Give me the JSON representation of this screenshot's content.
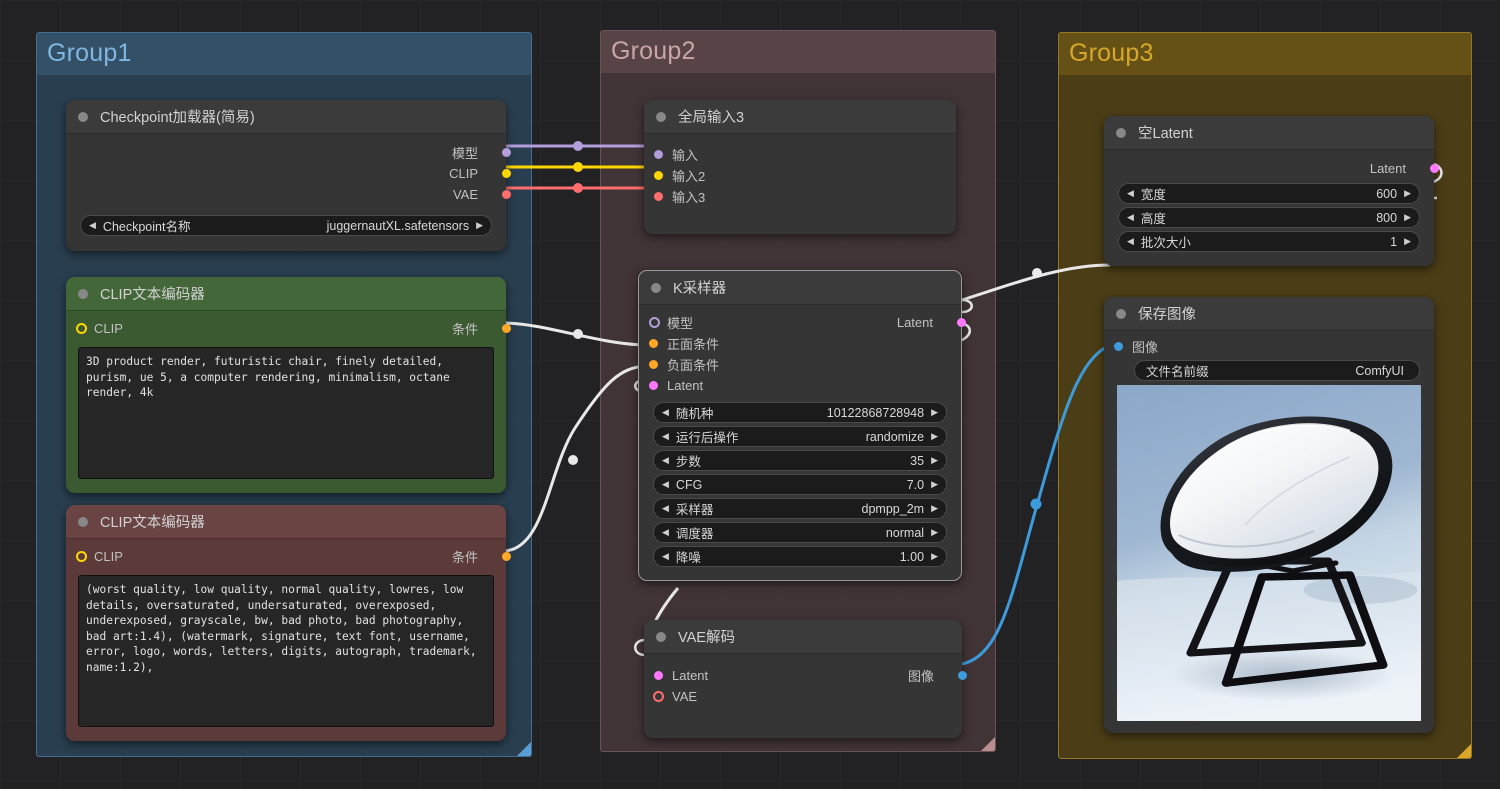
{
  "canvas": {
    "background_color": "#222225",
    "grid": true
  },
  "groups": [
    {
      "id": "group1",
      "title": "Group1",
      "color": "#5a9ed6"
    },
    {
      "id": "group2",
      "title": "Group2",
      "color": "#b98e8e"
    },
    {
      "id": "group3",
      "title": "Group3",
      "color": "#d8a72a"
    }
  ],
  "link_colors": {
    "model": "#b39ddb",
    "clip": "#ffd600",
    "vae": "#ff6e6e",
    "conditioning": "#ffa726",
    "latent": "#ff78ff",
    "image": "#3d9bdb",
    "generic": "#e8e8e8"
  },
  "nodes": {
    "checkpoint_loader": {
      "title": "Checkpoint加载器(简易)",
      "outputs": [
        {
          "label": "模型",
          "color": "#b39ddb"
        },
        {
          "label": "CLIP",
          "color": "#ffd600"
        },
        {
          "label": "VAE",
          "color": "#ff6e6e"
        }
      ],
      "widgets": [
        {
          "label": "Checkpoint名称",
          "value": "juggernautXL.safetensors",
          "type": "combo"
        }
      ]
    },
    "clip_positive": {
      "title": "CLIP文本编码器",
      "input": {
        "label": "CLIP",
        "color": "#ffd600"
      },
      "output": {
        "label": "条件",
        "color": "#ffa726"
      },
      "text": "3D product render, futuristic chair, finely detailed, purism, ue 5, a computer rendering, minimalism, octane render, 4k"
    },
    "clip_negative": {
      "title": "CLIP文本编码器",
      "input": {
        "label": "CLIP",
        "color": "#ffd600"
      },
      "output": {
        "label": "条件",
        "color": "#ffa726"
      },
      "text": "(worst quality, low quality, normal quality, lowres, low details, oversaturated, undersaturated, overexposed, underexposed, grayscale, bw, bad photo, bad photography, bad art:1.4), (watermark, signature, text font, username, error, logo, words, letters, digits, autograph, trademark, name:1.2),"
    },
    "global_input": {
      "title": "全局输入3",
      "inputs": [
        {
          "label": "输入",
          "color": "#b39ddb"
        },
        {
          "label": "输入2",
          "color": "#ffd600"
        },
        {
          "label": "输入3",
          "color": "#ff6e6e"
        }
      ]
    },
    "ksampler": {
      "title": "K采样器",
      "inputs": [
        {
          "label": "模型",
          "color": "#b39ddb",
          "ring": true
        },
        {
          "label": "正面条件",
          "color": "#ffa726"
        },
        {
          "label": "负面条件",
          "color": "#ffa726"
        },
        {
          "label": "Latent",
          "color": "#ff78ff"
        }
      ],
      "outputs": [
        {
          "label": "Latent",
          "color": "#ff78ff"
        }
      ],
      "widgets": [
        {
          "label": "随机种",
          "value": "10122868728948"
        },
        {
          "label": "运行后操作",
          "value": "randomize"
        },
        {
          "label": "步数",
          "value": "35"
        },
        {
          "label": "CFG",
          "value": "7.0"
        },
        {
          "label": "采样器",
          "value": "dpmpp_2m"
        },
        {
          "label": "调度器",
          "value": "normal"
        },
        {
          "label": "降噪",
          "value": "1.00"
        }
      ]
    },
    "vae_decode": {
      "title": "VAE解码",
      "inputs": [
        {
          "label": "Latent",
          "color": "#ff78ff"
        },
        {
          "label": "VAE",
          "color": "#ff6e6e",
          "ring": true
        }
      ],
      "outputs": [
        {
          "label": "图像",
          "color": "#3d9bdb"
        }
      ]
    },
    "empty_latent": {
      "title": "空Latent",
      "outputs": [
        {
          "label": "Latent",
          "color": "#ff78ff"
        }
      ],
      "widgets": [
        {
          "label": "宽度",
          "value": "600"
        },
        {
          "label": "高度",
          "value": "800"
        },
        {
          "label": "批次大小",
          "value": "1"
        }
      ]
    },
    "save_image": {
      "title": "保存图像",
      "inputs": [
        {
          "label": "图像",
          "color": "#3d9bdb"
        }
      ],
      "widgets": [
        {
          "label": "文件名前缀",
          "value": "ComfyUI"
        }
      ],
      "preview_alt": "Rendered 3D product image of a white and black futuristic shell chair on black sled legs against a blue-gray studio backdrop"
    }
  },
  "arrows": {
    "left": "◀",
    "right": "▶"
  }
}
